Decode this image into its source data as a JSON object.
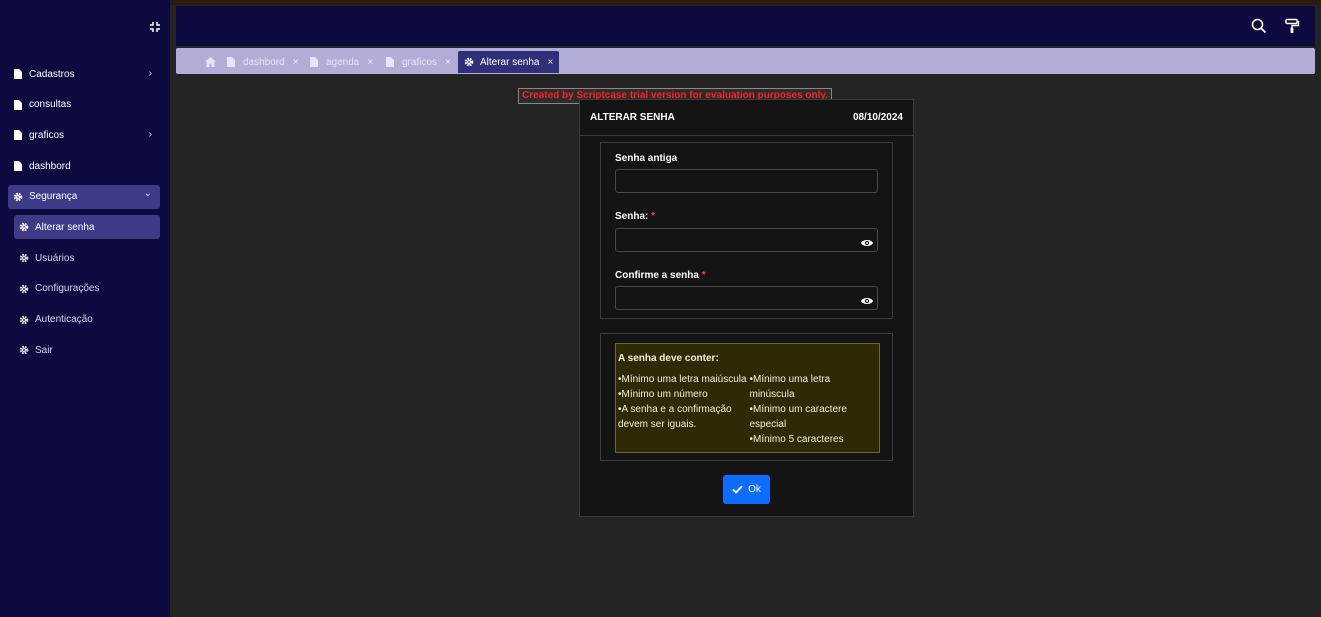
{
  "sidebar": {
    "items": [
      {
        "label": "Cadastros",
        "chevron": "›"
      },
      {
        "label": "consultas"
      },
      {
        "label": "graficos",
        "chevron": "›"
      },
      {
        "label": "dashbord"
      },
      {
        "label": "Segurança",
        "chevron": "⌄"
      }
    ],
    "sub_items": [
      {
        "label": "Alterar senha"
      },
      {
        "label": "Usuários"
      },
      {
        "label": "Configurações"
      },
      {
        "label": "Autenticação"
      },
      {
        "label": "Sair"
      }
    ]
  },
  "tabs": [
    {
      "label": "dashbord",
      "close": "×"
    },
    {
      "label": "agenda",
      "close": "×"
    },
    {
      "label": "graficos",
      "close": "×"
    },
    {
      "label": "Alterar senha",
      "close": "×"
    }
  ],
  "trial_notice": "Created by Scriptcase trial version for evaluation purposes only.",
  "form": {
    "title": "ALTERAR SENHA",
    "date": "08/10/2024",
    "fields": [
      {
        "label": "Senha antiga",
        "required_mark": ""
      },
      {
        "label": "Senha:",
        "required_mark": "*"
      },
      {
        "label": "Confirme a senha",
        "required_mark": "*"
      }
    ],
    "rules_title": "A senha deve conter:",
    "rules_col1": [
      "•Mínimo uma letra maiúscula",
      "•Mínimo um número",
      "•A senha e a confirmação devem ser iguais."
    ],
    "rules_col2": [
      "•Mínimo uma letra minúscula",
      "•Mínimo um caractere especial",
      "•Mínimo 5 caracteres"
    ],
    "ok_label": "Ok"
  },
  "colors": {
    "sidebar_bg": "#0c0a3e",
    "active_item": "#3d3a88",
    "tabs_bg": "#b0aed6",
    "ok_button": "#0d6efd",
    "required": "#ff3b3b",
    "trial_text": "#ff2020"
  }
}
